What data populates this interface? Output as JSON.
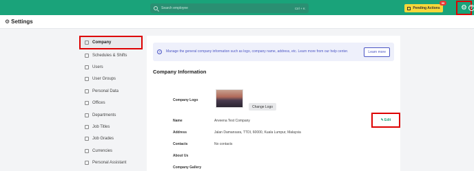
{
  "topbar": {
    "search_placeholder": "Search employee",
    "search_shortcut": "Ctrl + K",
    "pending_label": "Pending Actions",
    "pending_badge": "99",
    "help_glyph": "?",
    "accent_color": "#1aa37a"
  },
  "header": {
    "title": "Settings"
  },
  "sidebar": {
    "items": [
      {
        "label": "Company",
        "active": true
      },
      {
        "label": "Schedules & Shifts"
      },
      {
        "label": "Users"
      },
      {
        "label": "User Groups"
      },
      {
        "label": "Personal Data"
      },
      {
        "label": "Offices"
      },
      {
        "label": "Departments"
      },
      {
        "label": "Job Titles"
      },
      {
        "label": "Job Grades"
      },
      {
        "label": "Currencies"
      },
      {
        "label": "Personal Assistant"
      }
    ]
  },
  "main": {
    "info_text": "Manage the general company information such as logo, company name, address, etc. Learn more from our help center.",
    "learn_more": "Learn more",
    "section_title": "Company Information",
    "change_logo": "Change Logo",
    "edit_label": "Edit",
    "rows": {
      "logo_label": "Company Logo",
      "name_label": "Name",
      "name_value": "Arveena Test Company",
      "address_label": "Address",
      "address_value": "Jalan Damansara, TTDI, 60000, Kuala Lumpur, Malaysia",
      "contacts_label": "Contacts",
      "contacts_value": "No contacts",
      "about_label": "About Us",
      "gallery_label": "Company Gallery"
    }
  }
}
